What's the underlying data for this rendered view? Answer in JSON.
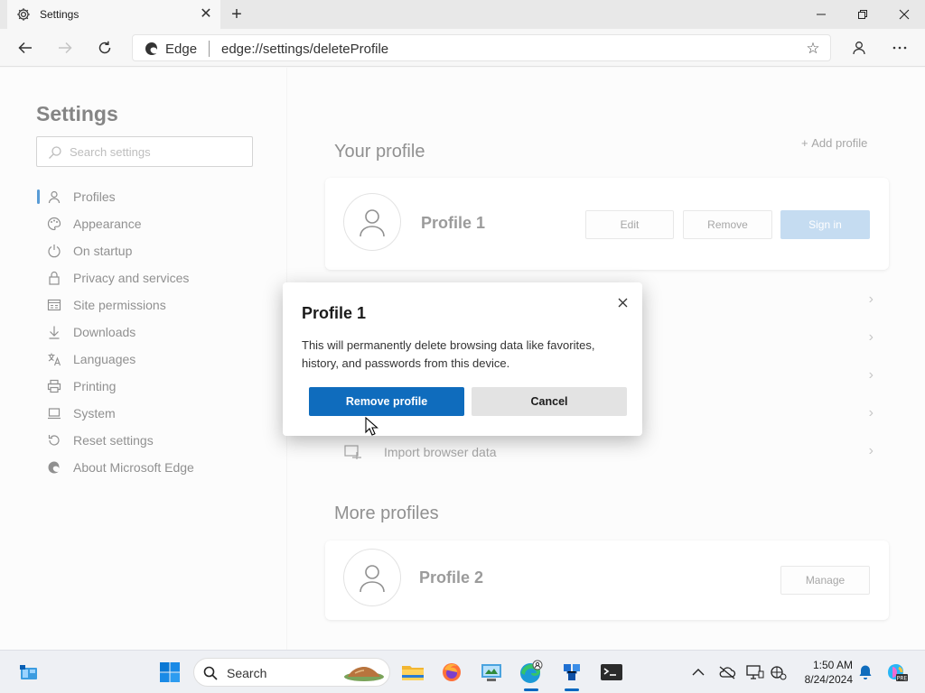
{
  "browser": {
    "tab_title": "Settings",
    "omnibox_label": "Edge",
    "url": "edge://settings/deleteProfile"
  },
  "settings": {
    "heading": "Settings",
    "search_placeholder": "Search settings",
    "nav": [
      {
        "label": "Profiles",
        "icon": "person-icon",
        "active": true
      },
      {
        "label": "Appearance",
        "icon": "palette-icon"
      },
      {
        "label": "On startup",
        "icon": "power-icon"
      },
      {
        "label": "Privacy and services",
        "icon": "lock-icon"
      },
      {
        "label": "Site permissions",
        "icon": "site-permissions-icon"
      },
      {
        "label": "Downloads",
        "icon": "download-icon"
      },
      {
        "label": "Languages",
        "icon": "languages-icon"
      },
      {
        "label": "Printing",
        "icon": "printer-icon"
      },
      {
        "label": "System",
        "icon": "laptop-icon"
      },
      {
        "label": "Reset settings",
        "icon": "reset-icon"
      },
      {
        "label": "About Microsoft Edge",
        "icon": "edge-logo-icon"
      }
    ]
  },
  "main": {
    "your_profile_title": "Your profile",
    "add_profile": "Add profile",
    "current_profile": {
      "name": "Profile 1",
      "edit": "Edit",
      "remove": "Remove",
      "sign_in": "Sign in"
    },
    "import_row": "Import browser data",
    "more_profiles_title": "More profiles",
    "other_profile": {
      "name": "Profile 2",
      "manage": "Manage"
    }
  },
  "dialog": {
    "title": "Profile 1",
    "message": "This will permanently delete browsing data like favorites, history, and passwords from this device.",
    "confirm": "Remove profile",
    "cancel": "Cancel"
  },
  "taskbar": {
    "search_label": "Search",
    "time": "1:50 AM",
    "date": "8/24/2024"
  },
  "colors": {
    "accent": "#0f6cbd",
    "signin_disabled": "#a7c9ea"
  }
}
